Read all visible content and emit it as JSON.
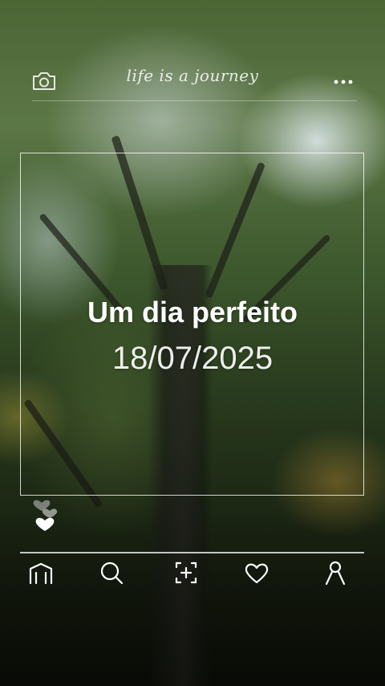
{
  "header": {
    "title": "life is a journey",
    "camera_icon": "camera-icon",
    "more_icon": "more-horizontal-icon"
  },
  "card": {
    "headline": "Um dia perfeito",
    "date": "18/07/2025"
  },
  "reactions": {
    "icon": "hearts-icon"
  },
  "bottom_nav": {
    "items": [
      {
        "icon": "home-icon"
      },
      {
        "icon": "search-icon"
      },
      {
        "icon": "add-post-icon"
      },
      {
        "icon": "heart-icon"
      },
      {
        "icon": "profile-icon"
      }
    ]
  },
  "colors": {
    "overlay_text": "#ffffff",
    "frame_border": "#ffffff"
  }
}
